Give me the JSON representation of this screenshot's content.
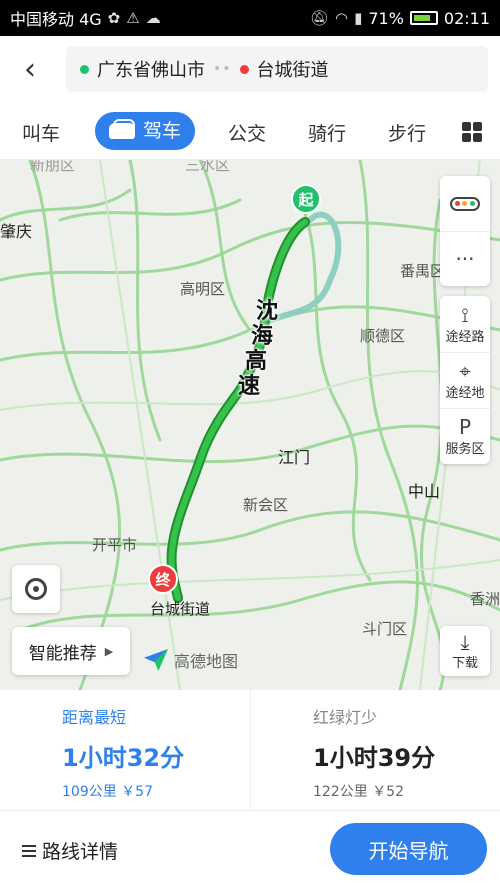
{
  "status_bar": {
    "carrier": "中国移动 4G",
    "battery": "71%",
    "time": "02:11"
  },
  "header": {
    "origin": "广东省佛山市",
    "destination": "台城街道"
  },
  "tabs": [
    {
      "label": "叫车"
    },
    {
      "label": "驾车"
    },
    {
      "label": "公交"
    },
    {
      "label": "骑行"
    },
    {
      "label": "步行"
    }
  ],
  "map": {
    "places": {
      "zhaoqing": "肇庆",
      "gaoming": "高明区",
      "panyu": "番禺区",
      "shunde": "顺德区",
      "jiangmen": "江门",
      "zhongshan": "中山",
      "xinhui": "新会区",
      "kaiping": "开平市",
      "doumen": "斗门区",
      "xiangzhou": "香洲",
      "sanshui": "三水区",
      "xinghu": "新朋区"
    },
    "route_label": [
      "沈",
      "海",
      "高",
      "速"
    ],
    "start_marker": "起",
    "end_marker": "终",
    "dest_label": "台城街道",
    "brand": "高德地图",
    "smart_recommend": "智能推荐",
    "side_buttons": {
      "waypoint_road": "途经路",
      "waypoint_place": "途经地",
      "service_area": "服务区",
      "download": "下载"
    }
  },
  "options": [
    {
      "tag": "距离最短",
      "time": "1小时32分",
      "meta": "109公里 ￥57"
    },
    {
      "tag": "红绿灯少",
      "time": "1小时39分",
      "meta": "122公里 ￥52"
    }
  ],
  "bottom": {
    "detail_label": "路线详情",
    "start_label": "开始导航"
  }
}
